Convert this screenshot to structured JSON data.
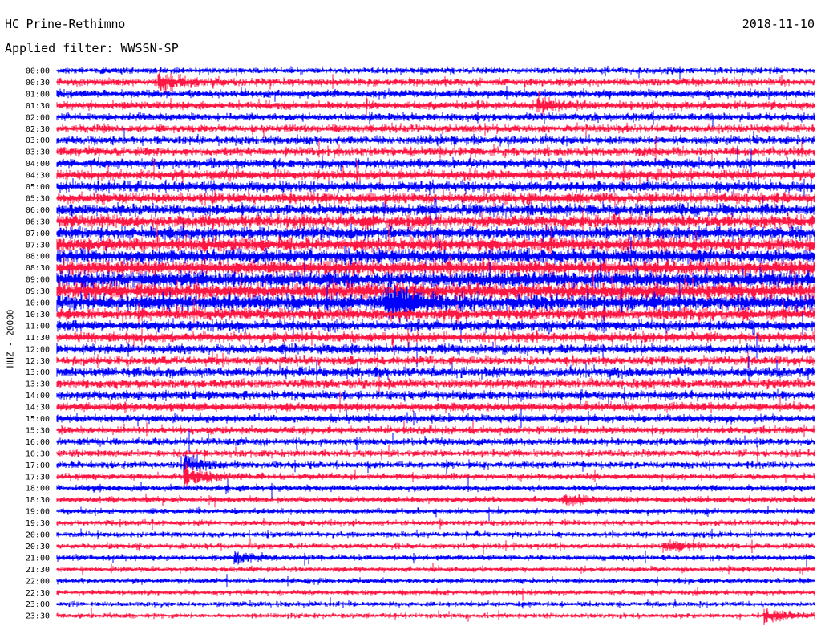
{
  "header": {
    "station": "HC Prine-Rethimno",
    "date": "2018-11-10",
    "filter_label": "Applied filter:",
    "filter_value": "WWSSN-SP",
    "channel_label": "HHZ - 20000"
  },
  "colors": {
    "series_a": "#0000ff",
    "series_b": "#ff1744",
    "background": "#ffffff"
  },
  "chart_data": {
    "type": "line",
    "title": "HC Prine-Rethimno",
    "subtitle": "Applied filter: WWSSN-SP",
    "date": "2018-11-10",
    "ylabel": "HHZ - 20000",
    "xlabel": "",
    "grid": false,
    "legend": "none",
    "trace_colors": [
      "#0000ff",
      "#ff1744"
    ],
    "rows": [
      "00:00",
      "00:30",
      "01:00",
      "01:30",
      "02:00",
      "02:30",
      "03:00",
      "03:30",
      "04:00",
      "04:30",
      "05:00",
      "05:30",
      "06:00",
      "06:30",
      "07:00",
      "07:30",
      "08:00",
      "08:30",
      "09:00",
      "09:30",
      "10:00",
      "10:30",
      "11:00",
      "11:30",
      "12:00",
      "12:30",
      "13:00",
      "13:30",
      "14:00",
      "14:30",
      "15:00",
      "15:30",
      "16:00",
      "16:30",
      "17:00",
      "17:30",
      "18:00",
      "18:30",
      "19:00",
      "19:30",
      "20:00",
      "20:30",
      "21:00",
      "21:30",
      "22:00",
      "22:30",
      "23:00",
      "23:30"
    ],
    "noise_level": [
      0.55,
      0.7,
      0.65,
      0.72,
      0.68,
      0.7,
      0.75,
      0.78,
      0.85,
      0.9,
      0.95,
      1.0,
      1.05,
      1.15,
      1.2,
      1.25,
      1.3,
      1.35,
      1.45,
      1.5,
      1.45,
      1.1,
      0.95,
      0.9,
      0.85,
      0.8,
      0.9,
      0.85,
      0.8,
      0.75,
      0.7,
      0.65,
      0.65,
      0.6,
      0.6,
      0.55,
      0.55,
      0.55,
      0.5,
      0.5,
      0.5,
      0.5,
      0.5,
      0.45,
      0.45,
      0.45,
      0.45,
      0.45
    ],
    "events": [
      {
        "row": 1,
        "minute": 4,
        "amp": 2.0
      },
      {
        "row": 3,
        "minute": 19,
        "amp": 1.8
      },
      {
        "row": 20,
        "minute": 13,
        "amp": 2.5
      },
      {
        "row": 34,
        "minute": 5,
        "amp": 2.5
      },
      {
        "row": 35,
        "minute": 5,
        "amp": 3.0
      },
      {
        "row": 37,
        "minute": 20,
        "amp": 1.8
      },
      {
        "row": 41,
        "minute": 24,
        "amp": 1.8
      },
      {
        "row": 42,
        "minute": 7,
        "amp": 1.8
      },
      {
        "row": 47,
        "minute": 28,
        "amp": 3.0
      }
    ]
  }
}
